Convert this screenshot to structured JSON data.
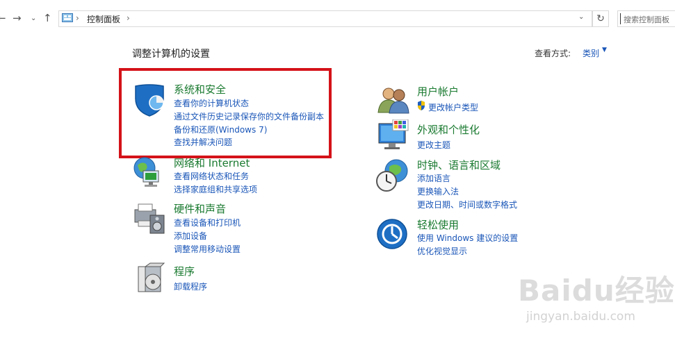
{
  "address_bar": {
    "path": "控制面板",
    "separator": "›",
    "search_placeholder": "搜索控制面板"
  },
  "main": {
    "heading": "调整计算机的设置",
    "view_by_label": "查看方式:",
    "view_by_value": "类别"
  },
  "categories": [
    {
      "title": "系统和安全",
      "links": [
        "查看你的计算机状态",
        "通过文件历史记录保存你的文件备份副本",
        "备份和还原(Windows 7)",
        "查找并解决问题"
      ]
    },
    {
      "title": "网络和 Internet",
      "links": [
        "查看网络状态和任务",
        "选择家庭组和共享选项"
      ]
    },
    {
      "title": "硬件和声音",
      "links": [
        "查看设备和打印机",
        "添加设备",
        "调整常用移动设置"
      ]
    },
    {
      "title": "程序",
      "links": [
        "卸载程序"
      ]
    },
    {
      "title": "用户帐户",
      "links": [
        "更改帐户类型"
      ]
    },
    {
      "title": "外观和个性化",
      "links": [
        "更改主题"
      ]
    },
    {
      "title": "时钟、语言和区域",
      "links": [
        "添加语言",
        "更换输入法",
        "更改日期、时间或数字格式"
      ]
    },
    {
      "title": "轻松使用",
      "links": [
        "使用 Windows 建议的设置",
        "优化视觉显示"
      ]
    }
  ],
  "watermark": {
    "brand": "Baidu经验",
    "url": "jingyan.baidu.com"
  },
  "colors": {
    "category_title": "#1a7a30",
    "link": "#1a56b8",
    "highlight_box": "#d41219"
  }
}
